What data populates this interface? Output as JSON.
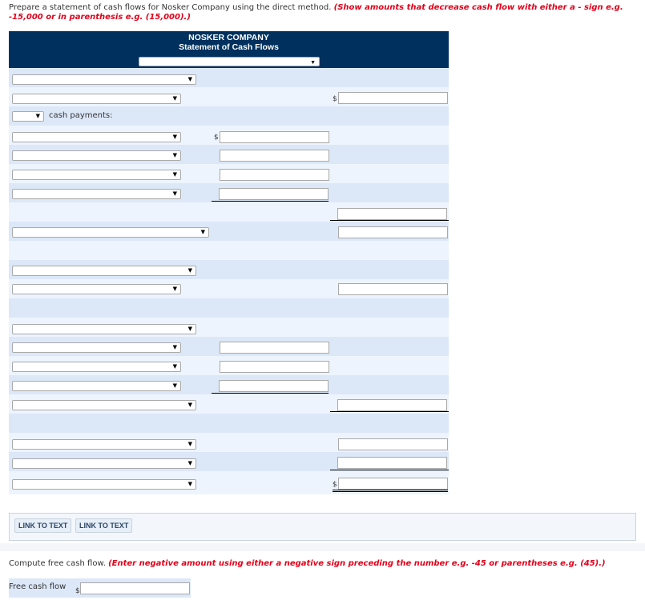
{
  "instructions": {
    "text": "Prepare a statement of cash flows for Nosker Company using the direct method.",
    "note": "(Show amounts that decrease cash flow with either a - sign e.g. -15,000 or in parenthesis e.g. (15,000).)"
  },
  "statement": {
    "company": "NOSKER COMPANY",
    "title": "Statement of Cash Flows",
    "period_select": "",
    "currency_symbol": "$",
    "cash_payments_label": "cash payments:"
  },
  "links": {
    "link1": "LINK TO TEXT",
    "link2": "LINK TO TEXT"
  },
  "free_cash_flow": {
    "instruction": "Compute free cash flow.",
    "note": "(Enter negative amount using either a negative sign preceding the number e.g. -45 or parentheses e.g. (45).)",
    "label": "Free cash flow",
    "currency_symbol": "$",
    "value": ""
  },
  "icons": {
    "dropdown": "▼"
  },
  "colors": {
    "header_bg": "#00305e",
    "row_dark": "#dce8f8",
    "row_light": "#edf4fd",
    "note_red": "#e2001a"
  }
}
